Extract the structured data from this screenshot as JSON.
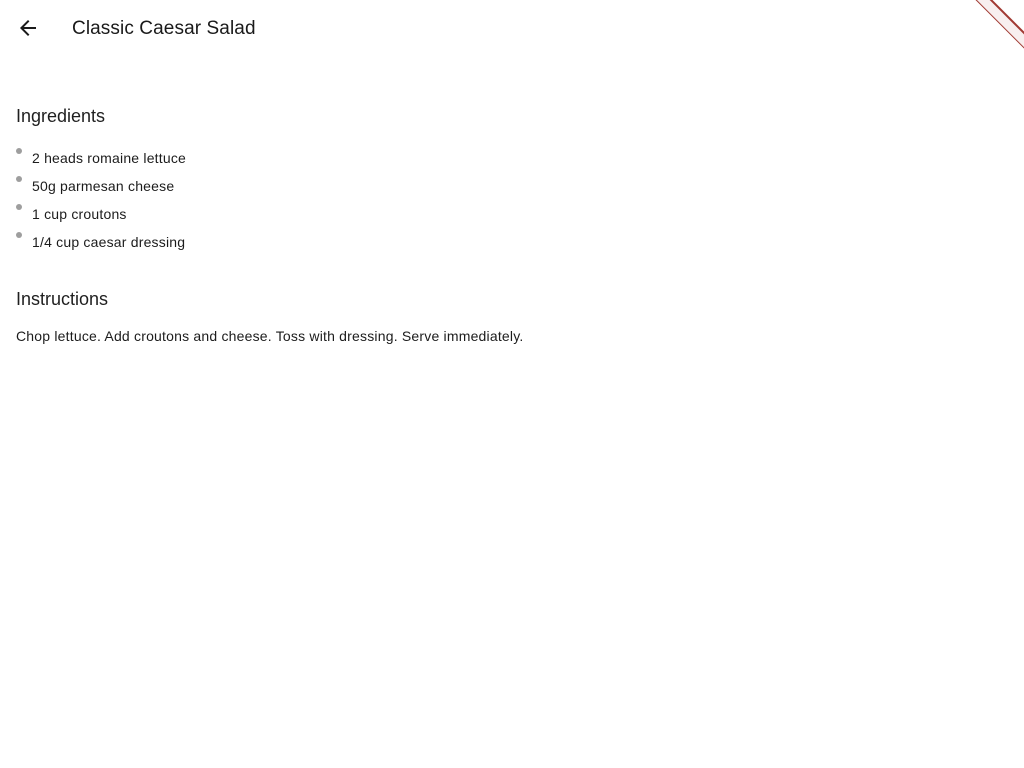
{
  "app_bar": {
    "title": "Classic Caesar Salad",
    "back_icon": "arrow-back-icon"
  },
  "ingredients": {
    "heading": "Ingredients",
    "items": [
      "2 heads romaine lettuce",
      "50g parmesan cheese",
      "1 cup croutons",
      "1/4 cup caesar dressing"
    ]
  },
  "instructions": {
    "heading": "Instructions",
    "text": "Chop lettuce. Add croutons and cheese. Toss with dressing. Serve immediately."
  },
  "colors": {
    "background": "#ffffff",
    "text": "#1c1c1c",
    "bullet": "#9e9e9e",
    "debug_banner": "#a13a33"
  }
}
